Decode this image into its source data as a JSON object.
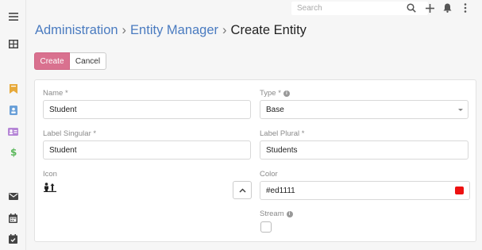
{
  "header": {
    "search_placeholder": "Search"
  },
  "breadcrumb": {
    "items": [
      "Administration",
      "Entity Manager"
    ],
    "separator": "›",
    "current": "Create Entity"
  },
  "actions": {
    "create_label": "Create",
    "cancel_label": "Cancel"
  },
  "form": {
    "name": {
      "label": "Name *",
      "value": "Student"
    },
    "type": {
      "label": "Type *",
      "value": "Base"
    },
    "label_singular": {
      "label": "Label Singular *",
      "value": "Student"
    },
    "label_plural": {
      "label": "Label Plural *",
      "value": "Students"
    },
    "icon": {
      "label": "Icon",
      "icon_name": "person-chalkboard-icon"
    },
    "color": {
      "label": "Color",
      "value": "#ed1111"
    },
    "stream": {
      "label": "Stream",
      "checked": false
    }
  },
  "sidebar_icons": [
    "menu-icon",
    "grid-icon",
    "bookmark-icon",
    "contact-card-icon",
    "id-card-icon",
    "dollar-icon",
    "mail-icon",
    "calendar-icon",
    "calendar-check-icon"
  ],
  "colors": {
    "primary_button": "#d9718f",
    "link": "#4a7bc0",
    "swatch": "#ed1111"
  }
}
